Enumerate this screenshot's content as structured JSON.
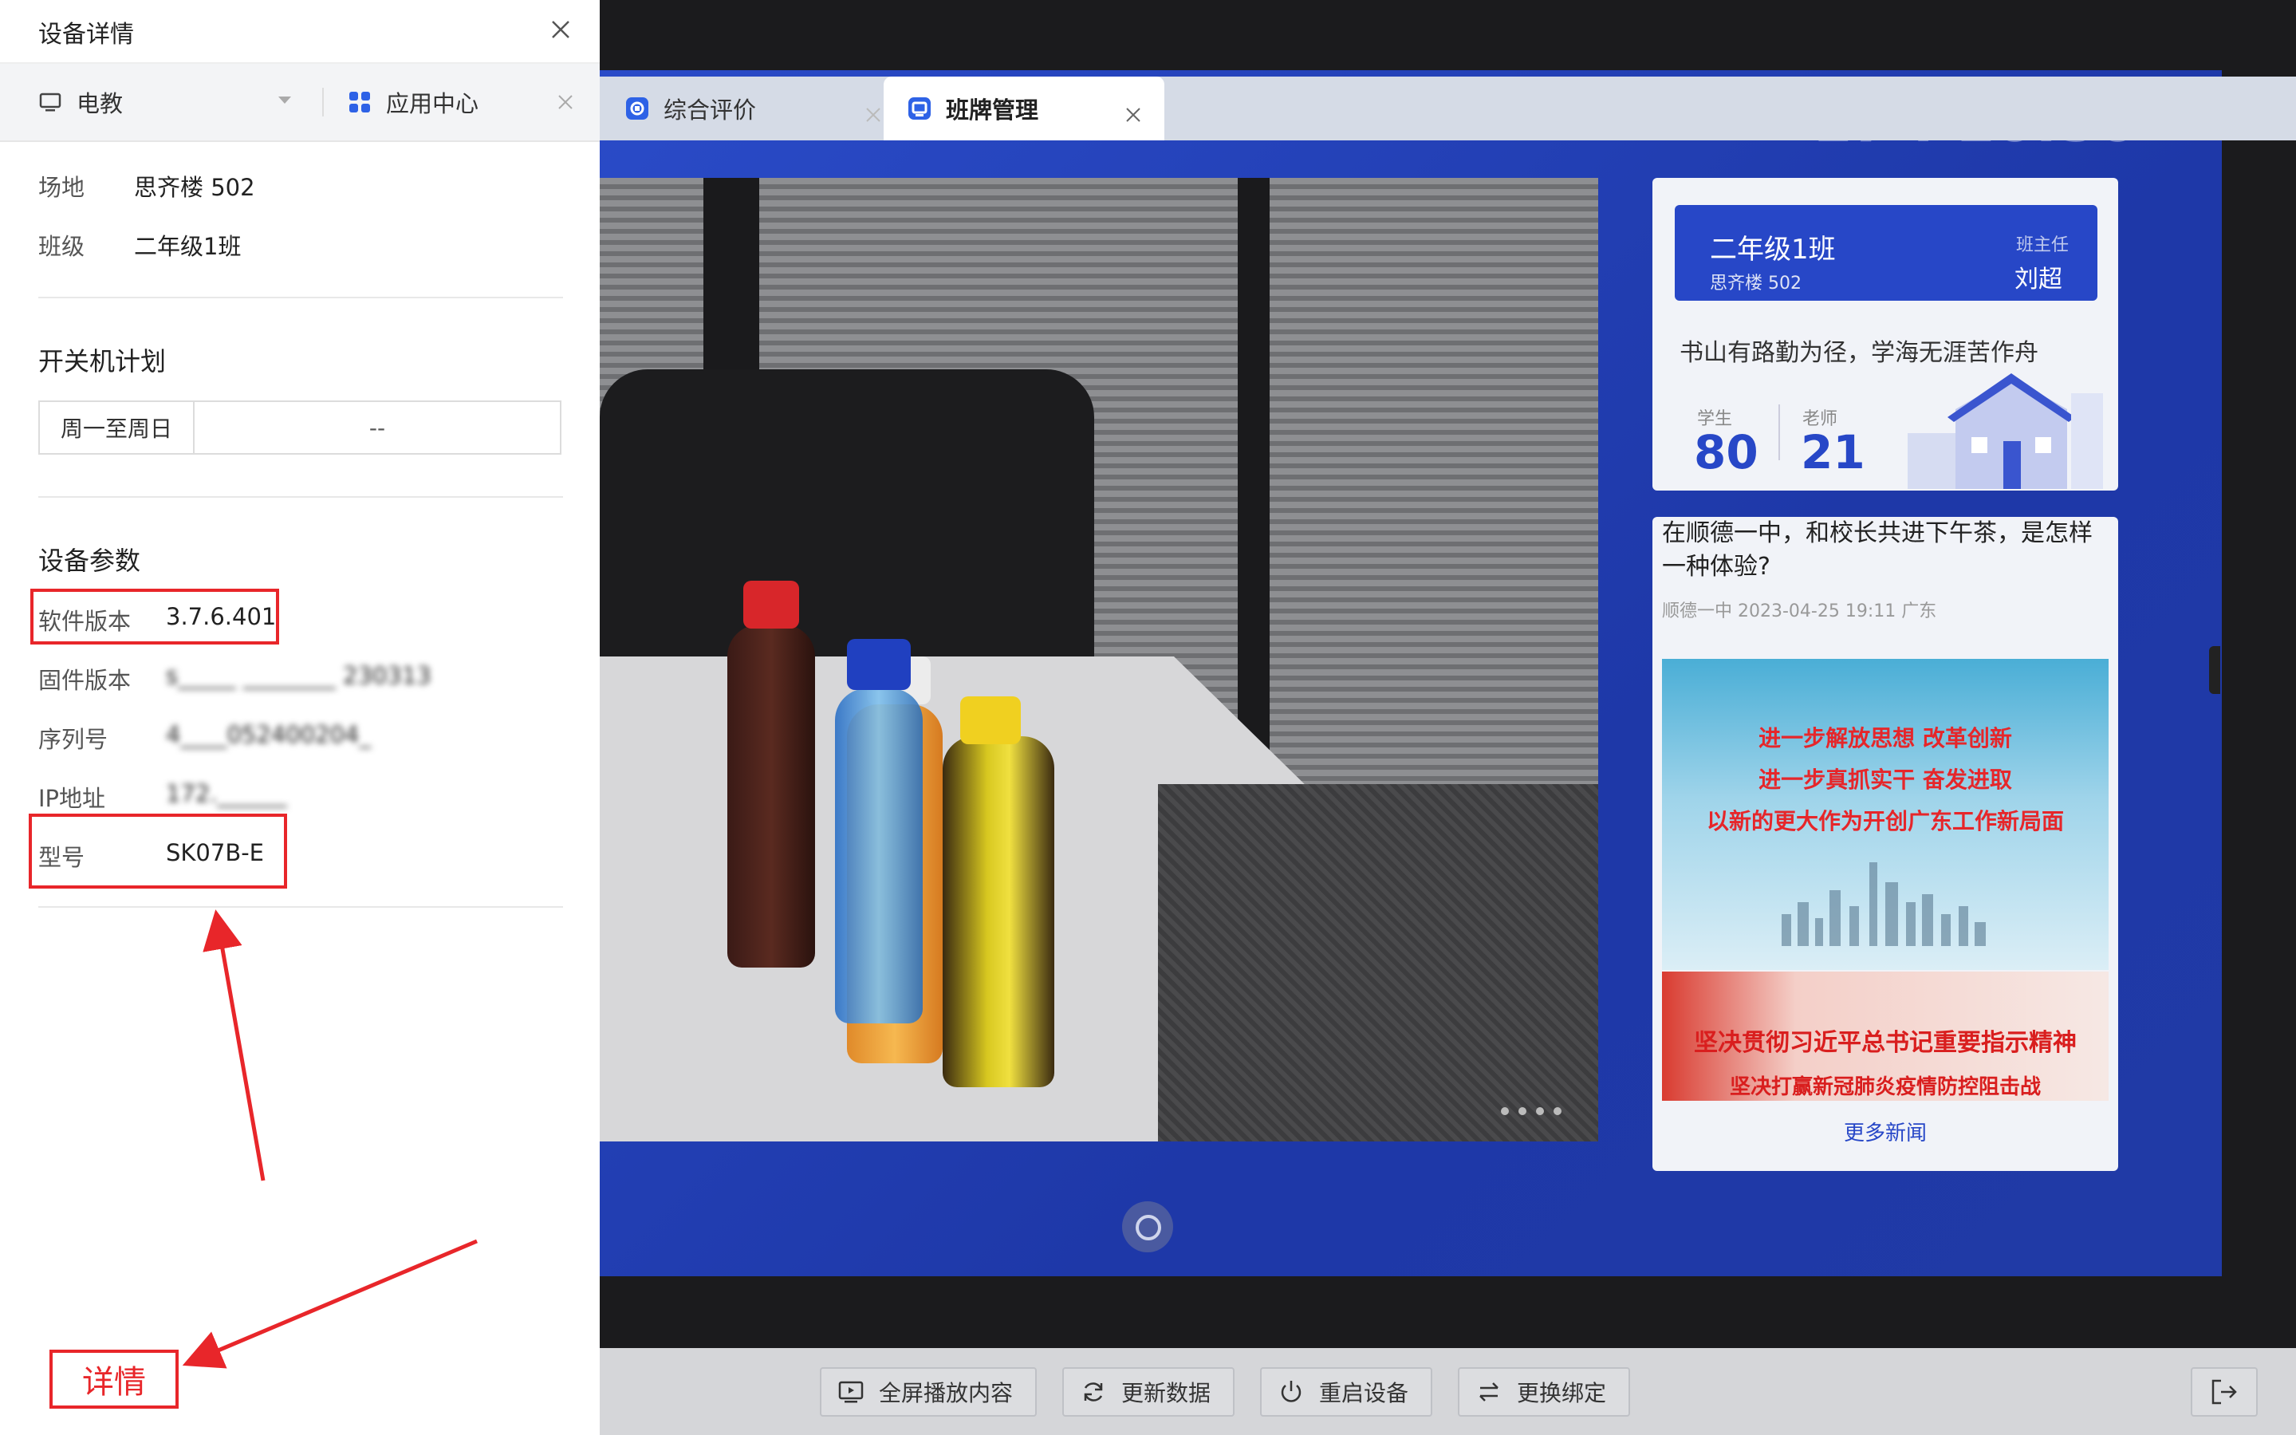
{
  "panel": {
    "title": "设备详情",
    "device_tab": "电教",
    "location_label": "场地",
    "location_value": "思齐楼 502",
    "class_label": "班级",
    "class_value": "二年级1班",
    "power_plan_title": "开关机计划",
    "schedule_days": "周一至周日",
    "schedule_time": "--",
    "params_title": "设备参数",
    "software_label": "软件版本",
    "software_value": "3.7.6.401",
    "firmware_label": "固件版本",
    "firmware_value": "s_____ ________ 230313",
    "serial_label": "序列号",
    "serial_value": "4____052400204_",
    "ip_label": "IP地址",
    "ip_value": "172.______",
    "model_label": "型号",
    "model_value": "SK07B-E"
  },
  "annotation": {
    "label": "详情",
    "color": "#e8262a"
  },
  "tabs": [
    {
      "label": "应用中心"
    },
    {
      "label": "综合评价"
    },
    {
      "label": "班牌管理",
      "active": true
    }
  ],
  "screen": {
    "class_name": "二年级1班",
    "class_location": "思齐楼 502",
    "teacher_title": "班主任",
    "teacher_name": "刘超",
    "motto": "书山有路勤为径，学海无涯苦作舟",
    "student_label": "学生",
    "student_count": "80",
    "teacher_label": "老师",
    "teacher_count": "21",
    "news_title": "在顺德一中，和校长共进下午茶，是怎样一种体验?",
    "news_meta": "顺德一中   2023-04-25 19:11   广东",
    "news1_lines": [
      "进一步解放思想 改革创新",
      "进一步真抓实干 奋发进取",
      "以新的更大作为开创广东工作新局面"
    ],
    "news2_lines": [
      "坚决贯彻习近平总书记重要指示精神",
      "坚决打赢新冠肺炎疫情防控阻击战"
    ],
    "more_news": "更多新闻"
  },
  "toolbar": {
    "fullscreen": "全屏播放内容",
    "refresh": "更新数据",
    "restart": "重启设备",
    "rebind": "更换绑定"
  },
  "colors": {
    "accent": "#2747c7",
    "screen_bg": "#1f3fb0",
    "red": "#e8262a"
  }
}
